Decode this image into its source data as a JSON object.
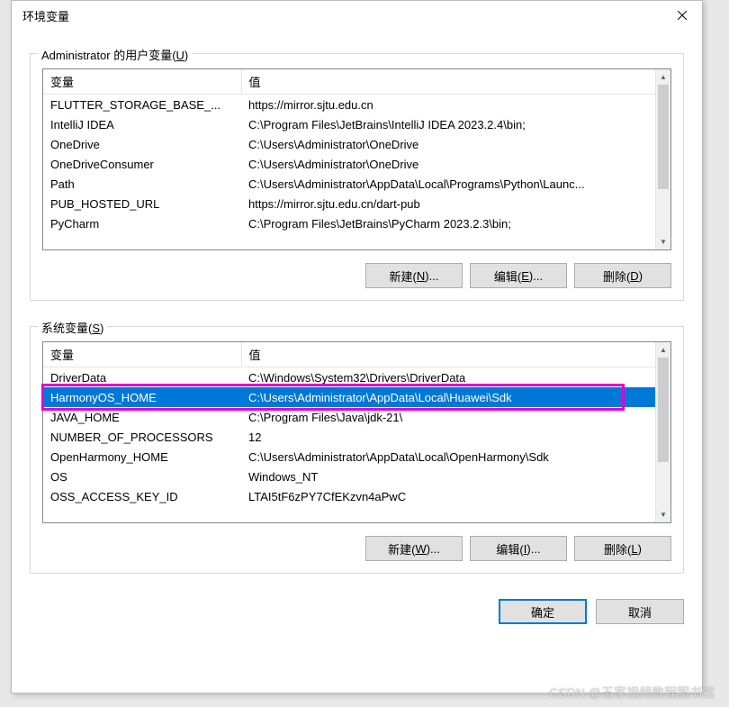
{
  "window": {
    "title": "环境变量"
  },
  "user_section": {
    "label_pre": "Administrator 的用户变量(",
    "label_u": "U",
    "label_post": ")",
    "headers": {
      "name": "变量",
      "value": "值"
    },
    "rows": [
      {
        "name": "FLUTTER_STORAGE_BASE_...",
        "value": "https://mirror.sjtu.edu.cn"
      },
      {
        "name": "IntelliJ IDEA",
        "value": "C:\\Program Files\\JetBrains\\IntelliJ IDEA 2023.2.4\\bin;"
      },
      {
        "name": "OneDrive",
        "value": "C:\\Users\\Administrator\\OneDrive"
      },
      {
        "name": "OneDriveConsumer",
        "value": "C:\\Users\\Administrator\\OneDrive"
      },
      {
        "name": "Path",
        "value": "C:\\Users\\Administrator\\AppData\\Local\\Programs\\Python\\Launc..."
      },
      {
        "name": "PUB_HOSTED_URL",
        "value": "https://mirror.sjtu.edu.cn/dart-pub"
      },
      {
        "name": "PyCharm",
        "value": "C:\\Program Files\\JetBrains\\PyCharm 2023.2.3\\bin;"
      }
    ],
    "buttons": {
      "new": "新建(",
      "new_u": "N",
      "new_post": ")...",
      "edit": "编辑(",
      "edit_u": "E",
      "edit_post": ")...",
      "del": "删除(",
      "del_u": "D",
      "del_post": ")"
    }
  },
  "sys_section": {
    "label_pre": "系统变量(",
    "label_u": "S",
    "label_post": ")",
    "headers": {
      "name": "变量",
      "value": "值"
    },
    "rows": [
      {
        "name": "DriverData",
        "value": "C:\\Windows\\System32\\Drivers\\DriverData"
      },
      {
        "name": "HarmonyOS_HOME",
        "value": "C:\\Users\\Administrator\\AppData\\Local\\Huawei\\Sdk",
        "selected": true
      },
      {
        "name": "JAVA_HOME",
        "value": "C:\\Program Files\\Java\\jdk-21\\"
      },
      {
        "name": "NUMBER_OF_PROCESSORS",
        "value": "12"
      },
      {
        "name": "OpenHarmony_HOME",
        "value": "C:\\Users\\Administrator\\AppData\\Local\\OpenHarmony\\Sdk"
      },
      {
        "name": "OS",
        "value": "Windows_NT"
      },
      {
        "name": "OSS_ACCESS_KEY_ID",
        "value": "LTAI5tF6zPY7CfEKzvn4aPwC"
      }
    ],
    "buttons": {
      "new": "新建(",
      "new_u": "W",
      "new_post": ")...",
      "edit": "编辑(",
      "edit_u": "I",
      "edit_post": ")...",
      "del": "删除(",
      "del_u": "L",
      "del_post": ")"
    }
  },
  "dialog_buttons": {
    "ok": "确定",
    "cancel": "取消"
  },
  "watermark": "CSDN @王家视频教程图书馆"
}
